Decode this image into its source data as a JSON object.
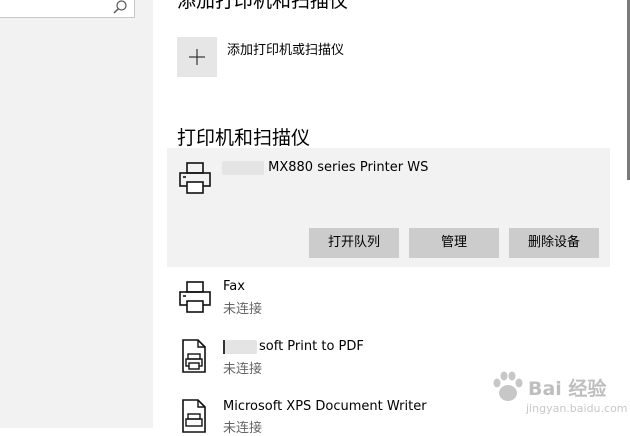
{
  "header": {
    "section_heading": "添加打印机和扫描仪"
  },
  "add_device": {
    "label": "添加打印机或扫描仪",
    "icon": "plus-icon"
  },
  "devices_section": {
    "title": "打印机和扫描仪",
    "devices": [
      {
        "name": "MX880 series Printer WS",
        "icon": "printer-icon",
        "selected": true,
        "actions": [
          "打开队列",
          "管理",
          "删除设备"
        ]
      },
      {
        "name": "Fax",
        "status": "未连接",
        "icon": "printer-icon"
      },
      {
        "name": "soft Print to PDF",
        "status": "未连接",
        "icon": "document-printer-icon"
      },
      {
        "name": "Microsoft XPS Document Writer",
        "status": "未连接",
        "icon": "document-printer-icon"
      }
    ]
  },
  "search": {
    "icon": "search-icon"
  },
  "watermark": {
    "brand": "Bai 经验",
    "url": "jingyan.baidu.com"
  },
  "colors": {
    "selected_bg": "#f2f2f2",
    "button_bg": "#cccccc",
    "sidebar_bg": "#f2f2f2"
  }
}
